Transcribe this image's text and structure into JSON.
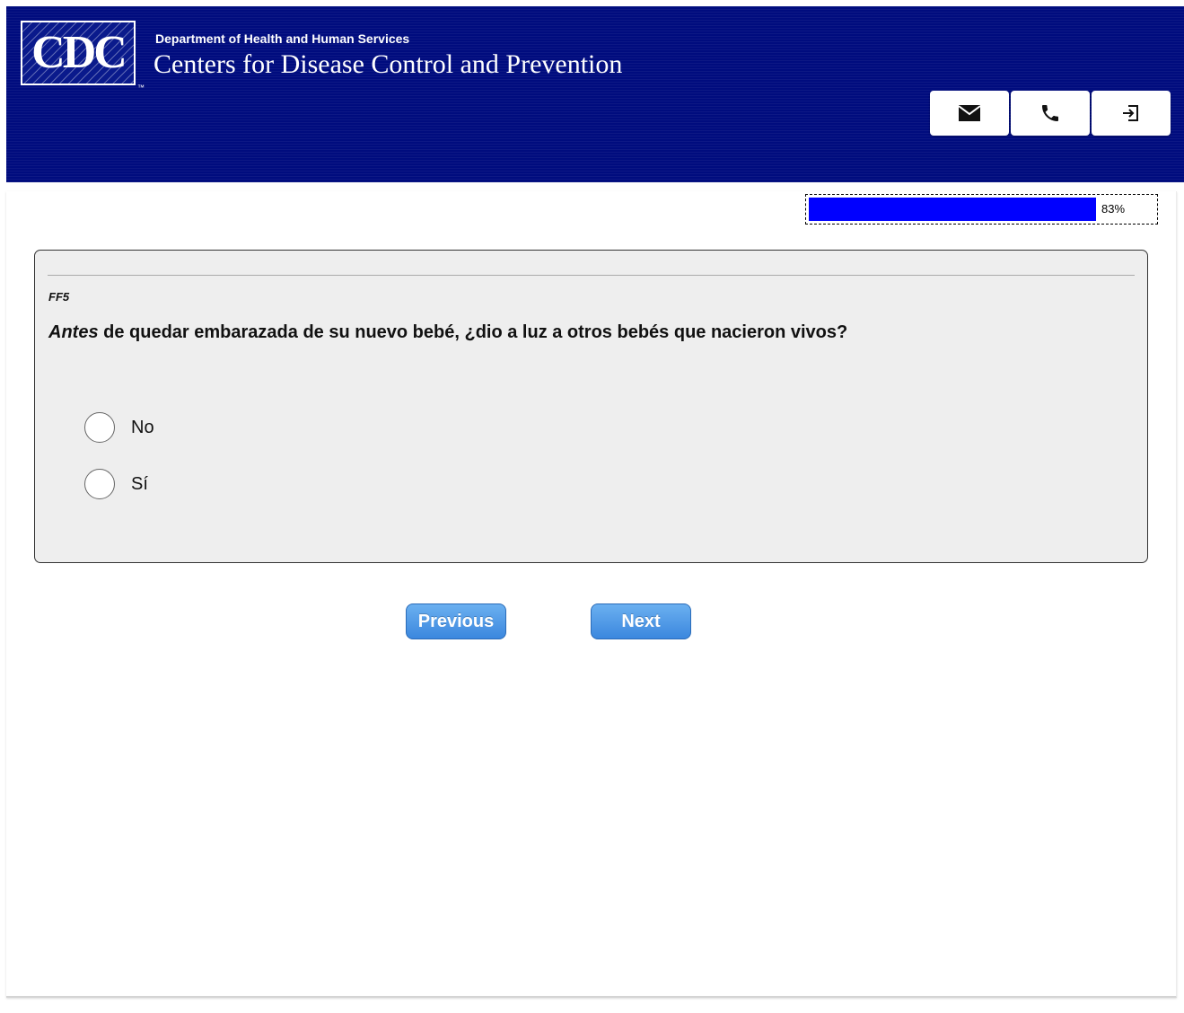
{
  "header": {
    "logo_text": "CDC",
    "department": "Department of Health and Human Services",
    "agency": "Centers for Disease Control and Prevention",
    "buttons": [
      {
        "icon": "mail-icon"
      },
      {
        "icon": "phone-icon"
      },
      {
        "icon": "exit-icon"
      }
    ],
    "background_color": "#000c7e"
  },
  "progress": {
    "value": 0.83,
    "label": "83%",
    "fill_color": "#0000ff"
  },
  "question": {
    "code": "FF5",
    "emphasis": "Antes",
    "text": " de quedar embarazada de su nuevo bebé, ¿dio a luz a otros bebés que nacieron vivos?",
    "options": [
      {
        "label": "No",
        "selected": false
      },
      {
        "label": "Sí",
        "selected": false
      }
    ]
  },
  "nav": {
    "previous_label": "Previous",
    "next_label": "Next"
  }
}
